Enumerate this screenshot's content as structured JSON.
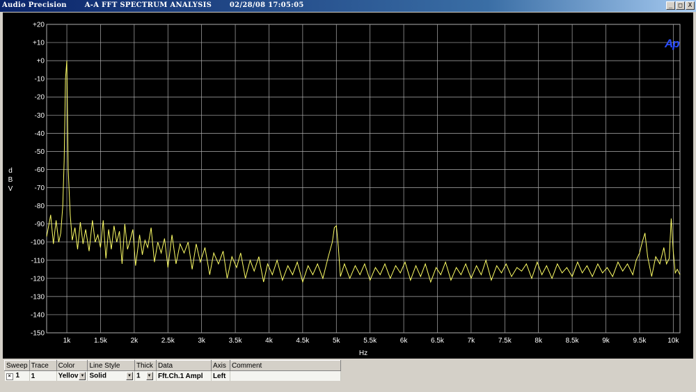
{
  "titlebar": {
    "app_name": "Audio Precision",
    "title": "A-A FFT SPECTRUM ANALYSIS",
    "timestamp": "02/28/08 17:05:05",
    "minimize": "_",
    "maximize": "□",
    "close": "X"
  },
  "logo_text": "Ap",
  "colors": {
    "trace": "#ffff66",
    "grid": "#b0b0b0",
    "background": "#000000",
    "axis_text": "#ffffff",
    "logo": "#2a4cff"
  },
  "chart_data": {
    "type": "line",
    "xlabel": "Hz",
    "ylabel": "dBV",
    "xlim": [
      700,
      10100
    ],
    "ylim": [
      -150,
      20
    ],
    "x_ticks": [
      1000,
      1500,
      2000,
      2500,
      3000,
      3500,
      4000,
      4500,
      5000,
      5500,
      6000,
      6500,
      7000,
      7500,
      8000,
      8500,
      9000,
      9500,
      10000
    ],
    "x_tick_labels": [
      "1k",
      "1.5k",
      "2k",
      "2.5k",
      "3k",
      "3.5k",
      "4k",
      "4.5k",
      "5k",
      "5.5k",
      "6k",
      "6.5k",
      "7k",
      "7.5k",
      "8k",
      "8.5k",
      "9k",
      "9.5k",
      "10k"
    ],
    "y_ticks": [
      20,
      10,
      0,
      -10,
      -20,
      -30,
      -40,
      -50,
      -60,
      -70,
      -80,
      -90,
      -100,
      -110,
      -120,
      -130,
      -140,
      -150
    ],
    "y_tick_labels": [
      "+20",
      "+10",
      "+0",
      "-10",
      "-20",
      "-30",
      "-40",
      "-50",
      "-60",
      "-70",
      "-80",
      "-90",
      "-100",
      "-110",
      "-120",
      "-130",
      "-140",
      "-150"
    ],
    "grid": true,
    "series": [
      {
        "x": [
          700,
          760,
          800,
          840,
          880,
          910,
          940,
          960,
          980,
          1000,
          1020,
          1050,
          1080,
          1120,
          1160,
          1200,
          1240,
          1280,
          1330,
          1380,
          1420,
          1460,
          1500,
          1540,
          1580,
          1620,
          1660,
          1700,
          1740,
          1780,
          1820,
          1860,
          1900,
          1940,
          1980,
          2020,
          2080,
          2120,
          2160,
          2200,
          2250,
          2300,
          2350,
          2400,
          2450,
          2500,
          2560,
          2620,
          2680,
          2740,
          2800,
          2860,
          2920,
          2980,
          3050,
          3120,
          3180,
          3250,
          3320,
          3380,
          3450,
          3520,
          3580,
          3650,
          3720,
          3780,
          3850,
          3920,
          3980,
          4050,
          4120,
          4200,
          4280,
          4350,
          4420,
          4500,
          4580,
          4650,
          4720,
          4800,
          4880,
          4940,
          4970,
          5000,
          5030,
          5060,
          5120,
          5200,
          5280,
          5350,
          5420,
          5500,
          5580,
          5650,
          5720,
          5800,
          5880,
          5950,
          6020,
          6100,
          6180,
          6250,
          6320,
          6400,
          6480,
          6550,
          6620,
          6700,
          6780,
          6850,
          6920,
          7000,
          7080,
          7150,
          7220,
          7300,
          7380,
          7450,
          7520,
          7600,
          7680,
          7750,
          7820,
          7900,
          7980,
          8050,
          8120,
          8200,
          8280,
          8350,
          8420,
          8500,
          8580,
          8650,
          8720,
          8800,
          8880,
          8950,
          9020,
          9100,
          9180,
          9250,
          9320,
          9400,
          9450,
          9500,
          9540,
          9580,
          9620,
          9680,
          9740,
          9800,
          9860,
          9900,
          9940,
          9970,
          10000,
          10030,
          10060,
          10100
        ],
        "y": [
          -97,
          -85,
          -101,
          -88,
          -100,
          -95,
          -80,
          -55,
          -10,
          0,
          -60,
          -85,
          -99,
          -92,
          -104,
          -89,
          -101,
          -93,
          -105,
          -88,
          -100,
          -96,
          -103,
          -88,
          -109,
          -93,
          -104,
          -91,
          -100,
          -94,
          -112,
          -90,
          -104,
          -99,
          -93,
          -113,
          -96,
          -107,
          -99,
          -103,
          -92,
          -111,
          -100,
          -106,
          -98,
          -114,
          -96,
          -112,
          -101,
          -106,
          -100,
          -115,
          -101,
          -111,
          -103,
          -118,
          -106,
          -112,
          -105,
          -120,
          -108,
          -114,
          -106,
          -120,
          -110,
          -116,
          -108,
          -122,
          -112,
          -118,
          -110,
          -121,
          -113,
          -118,
          -111,
          -122,
          -113,
          -118,
          -112,
          -120,
          -108,
          -100,
          -92,
          -91,
          -103,
          -119,
          -112,
          -120,
          -113,
          -118,
          -112,
          -121,
          -114,
          -118,
          -112,
          -120,
          -113,
          -117,
          -111,
          -121,
          -113,
          -119,
          -112,
          -122,
          -114,
          -118,
          -111,
          -121,
          -114,
          -118,
          -112,
          -120,
          -113,
          -118,
          -110,
          -121,
          -113,
          -117,
          -112,
          -119,
          -114,
          -116,
          -112,
          -120,
          -111,
          -118,
          -113,
          -120,
          -112,
          -117,
          -114,
          -119,
          -111,
          -117,
          -113,
          -119,
          -112,
          -117,
          -114,
          -119,
          -111,
          -116,
          -112,
          -118,
          -110,
          -106,
          -100,
          -95,
          -108,
          -119,
          -108,
          -112,
          -103,
          -112,
          -109,
          -87,
          -105,
          -117,
          -115,
          -118
        ]
      }
    ]
  },
  "legend": {
    "headers": [
      "Sweep",
      "Trace",
      "Color",
      "Line Style",
      "Thick",
      "Data",
      "Axis",
      "Comment"
    ],
    "rows": [
      {
        "sweep": "1",
        "trace": "1",
        "color": "Yellov",
        "line_style": "Solid",
        "thick": "1",
        "data": "Fft.Ch.1 Ampl",
        "axis": "Left",
        "comment": ""
      }
    ]
  }
}
